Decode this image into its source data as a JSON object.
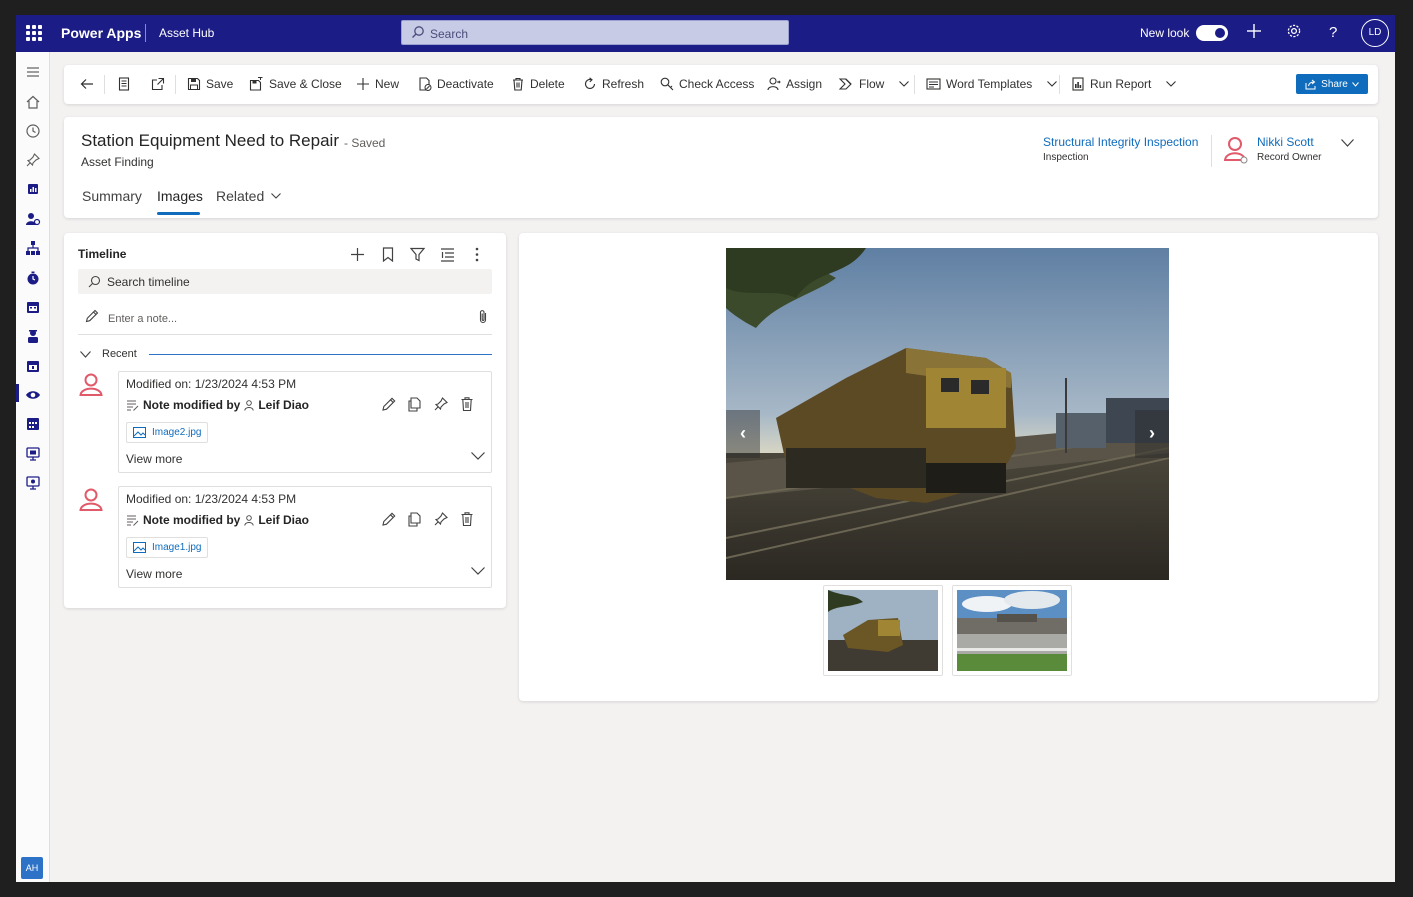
{
  "topbar": {
    "brand": "Power Apps",
    "app_name": "Asset Hub",
    "search_placeholder": "Search",
    "new_look_label": "New look",
    "new_look_on": true,
    "user_initials": "LD"
  },
  "rail": {
    "footer_initials": "AH"
  },
  "command_bar": {
    "save": "Save",
    "save_close": "Save & Close",
    "new": "New",
    "deactivate": "Deactivate",
    "delete": "Delete",
    "refresh": "Refresh",
    "check_access": "Check Access",
    "assign": "Assign",
    "flow": "Flow",
    "word_templates": "Word Templates",
    "run_report": "Run Report",
    "share": "Share"
  },
  "record": {
    "title": "Station Equipment Need to Repair",
    "status": "- Saved",
    "entity": "Asset Finding",
    "tabs": [
      "Summary",
      "Images",
      "Related"
    ],
    "active_tab": "Images",
    "related_record": "Structural Integrity Inspection",
    "related_record_type": "Inspection",
    "owner_name": "Nikki Scott",
    "owner_role": "Record Owner"
  },
  "timeline": {
    "title": "Timeline",
    "search_placeholder": "Search timeline",
    "note_placeholder": "Enter a note...",
    "recent_label": "Recent",
    "entries": [
      {
        "modified": "Modified on: 1/23/2024 4:53 PM",
        "action": "Note modified by",
        "author": "Leif Diao",
        "attachment": "Image2.jpg",
        "view_more": "View more"
      },
      {
        "modified": "Modified on: 1/23/2024 4:53 PM",
        "action": "Note modified by",
        "author": "Leif Diao",
        "attachment": "Image1.jpg",
        "view_more": "View more"
      }
    ]
  },
  "gallery": {
    "prev_glyph": "‹",
    "next_glyph": "›"
  },
  "colors": {
    "topbar": "#1c1c87",
    "accent": "#0f6cbd",
    "persona": "#e05a6a"
  }
}
